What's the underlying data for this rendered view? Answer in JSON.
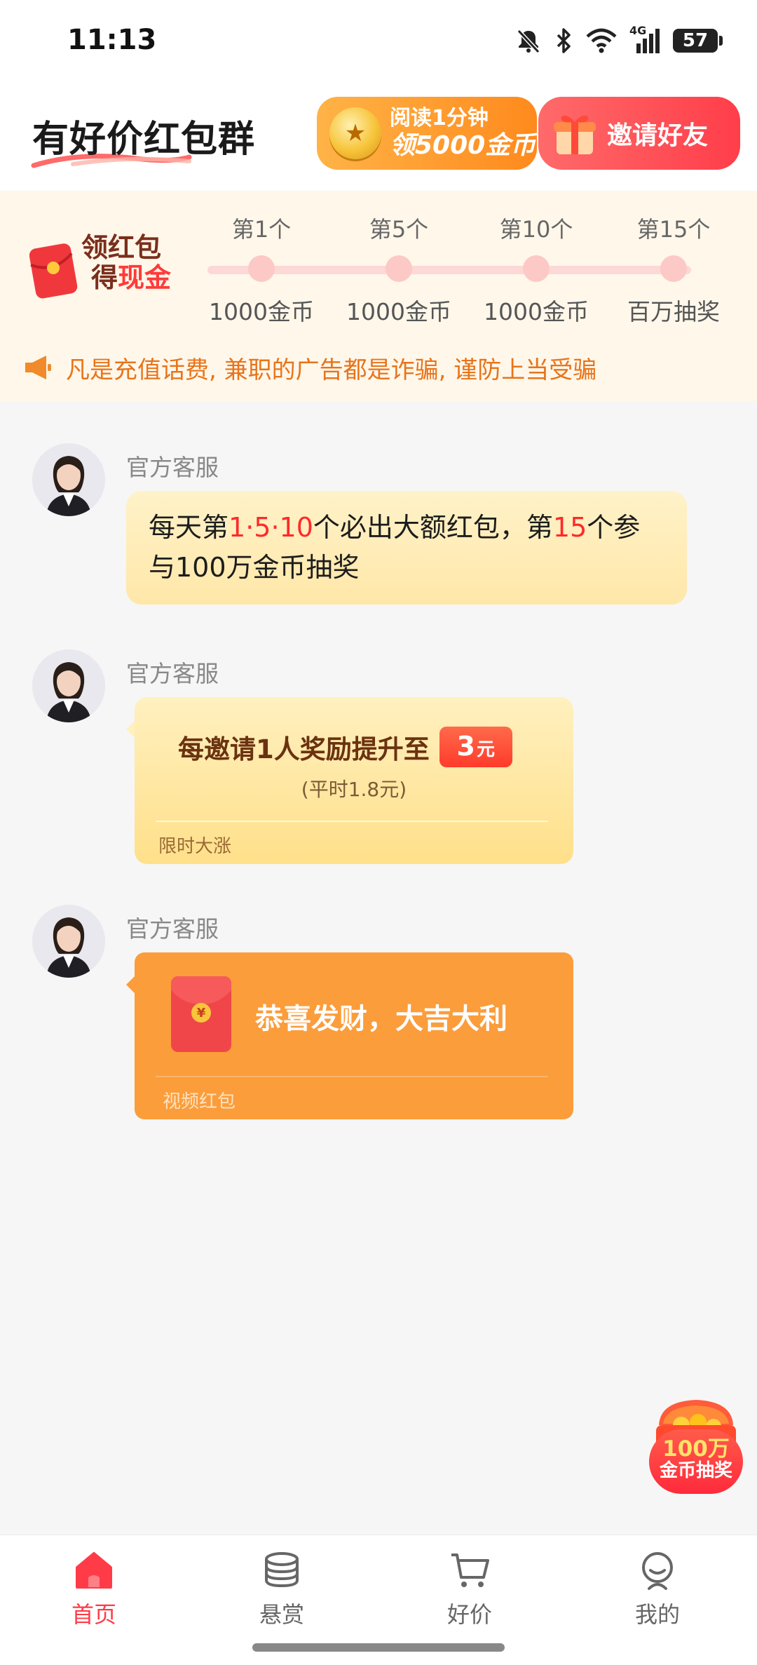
{
  "status_bar": {
    "time": "11:13",
    "network_label": "4G",
    "battery": "57"
  },
  "header": {
    "title": "有好价红包群",
    "read_promo": {
      "line1": "阅读1分钟",
      "line2": "领5000金币"
    },
    "invite_button": "邀请好友"
  },
  "progress": {
    "label_line1": "领红包",
    "label_line2_prefix": "得",
    "label_line2_hot": "现金",
    "milestones": [
      {
        "top": "第1个",
        "bottom": "1000金币"
      },
      {
        "top": "第5个",
        "bottom": "1000金币"
      },
      {
        "top": "第10个",
        "bottom": "1000金币"
      },
      {
        "top": "第15个",
        "bottom": "百万抽奖"
      }
    ],
    "notice": "凡是充值话费, 兼职的广告都是诈骗, 谨防上当受骗"
  },
  "chat": {
    "messages": [
      {
        "sender": "官方客服",
        "parts": [
          "每天第",
          "1·5·10",
          "个必出大额红包，第",
          "15",
          "个参与100万金币抽奖"
        ]
      },
      {
        "sender": "官方客服",
        "invite_text": "每邀请1人奖励提升至",
        "amount": "3",
        "unit": "元",
        "sub": "(平时1.8元)",
        "tag": "限时大涨"
      },
      {
        "sender": "官方客服",
        "greeting": "恭喜发财，大吉大利",
        "tag": "视频红包"
      }
    ]
  },
  "lottery": {
    "line1": "100万",
    "line2": "金币抽奖"
  },
  "nav": {
    "items": [
      {
        "label": "首页",
        "icon": "home-icon",
        "active": true
      },
      {
        "label": "悬赏",
        "icon": "coins-icon",
        "active": false
      },
      {
        "label": "好价",
        "icon": "cart-icon",
        "active": false
      },
      {
        "label": "我的",
        "icon": "profile-icon",
        "active": false
      }
    ]
  },
  "colors": {
    "accent_red": "#ff3b47",
    "notice_orange": "#e8741a",
    "video_packet_orange": "#fb9d3b"
  }
}
